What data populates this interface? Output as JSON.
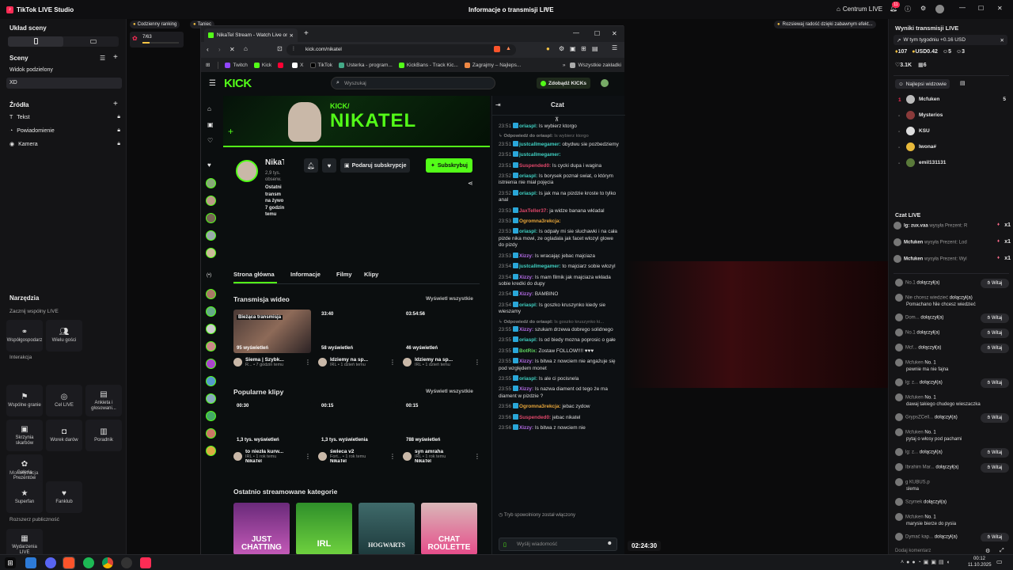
{
  "titlebar": {
    "app": "TikTok LIVE Studio",
    "center": "Informacje o transmisji LIVE",
    "centrum": "Centrum LIVE",
    "notif_count": "11"
  },
  "left": {
    "scene_layout": "Układ sceny",
    "scenes_title": "Sceny",
    "scenes": [
      "Widok podzielony",
      "XD"
    ],
    "sources_title": "Źródła",
    "sources": [
      "Tekst",
      "Powiadomienie",
      "Kamera"
    ],
    "tools_title": "Narzędzia",
    "collab_title": "Zacznij wspólny LIVE",
    "collab": [
      "Współgospodarz",
      "Wielu gości"
    ],
    "interaction_title": "Interakcja",
    "interaction": [
      "Wspólne granie",
      "Cel LIVE",
      "Ankieta i głosowani...",
      "Skrzynia skarbów",
      "Worek darów",
      "Poradnik",
      "Galeria Prezentów"
    ],
    "monet_title": "Monetyzacja",
    "monet": [
      "Superfan",
      "Fanklub"
    ],
    "ext_title": "Rozszerz publiczność",
    "ext": [
      "Wydarzenia LIVE"
    ]
  },
  "floating": {
    "daily": "Codzienny ranking",
    "daily_sub": "7/63",
    "taniec": "Taniec",
    "banner": "Rozsiewaj radość dzięki zabawnym efekt..."
  },
  "browser": {
    "tab_title": "NikaTel Stream - Watch Live on K",
    "url": "kick.com/nikatel",
    "bookmarks": [
      "Twitch",
      "Kick",
      "",
      "X",
      "TikTok",
      "Usterka - program...",
      "KickBans - Track Kic...",
      "Zagrajmy – Najleps..."
    ],
    "all_bookmarks": "Wszystkie zakładki"
  },
  "kick": {
    "logo": "KICK",
    "search_placeholder": "Wyszukaj",
    "get_kicks": "Zdobądź KICKs",
    "banner_top": "KICK/",
    "banner_name": "NIKATEL",
    "channel_name": "NikaTel",
    "followers": "2,9 tys. obserw.",
    "last_stream": "Ostatni transm na żywo 7 godzin temu",
    "gift_sub": "Podaruj subskrypcje",
    "subscribe": "Subskrybuj",
    "tabs": [
      "Strona główna",
      "Informacje",
      "Filmy",
      "Klipy"
    ],
    "videos_title": "Transmisja wideo",
    "see_all": "Wyświetl wszystkie",
    "videos": [
      {
        "dur": "Bieżąca transmisja",
        "views": "95 wyświetleń",
        "title": "Siema | Szybk...",
        "sub": "R... • 7 godzin temu"
      },
      {
        "dur": "33:40",
        "views": "58 wyświetleń",
        "title": "Idziemy na sp...",
        "sub": "IRL • 1 dzień temu"
      },
      {
        "dur": "03:54:56",
        "views": "46 wyświetleń",
        "title": "Idziemy na sp...",
        "sub": "IRL • 1 dzień temu"
      }
    ],
    "clips_title": "Popularne klipy",
    "clips": [
      {
        "dur": "00:30",
        "views": "1,3 tys. wyświetleń",
        "title": "to niezła kurw...",
        "sub": "IRL • 1 rok temu",
        "author": "NikaTel"
      },
      {
        "dur": "00:15",
        "views": "1,3 tys. wyświetlenia",
        "title": "świeca v2",
        "sub": "Fort... • 1 rok temu",
        "author": "NikaTel"
      },
      {
        "dur": "00:15",
        "views": "788 wyświetleń",
        "title": "syn amraha",
        "sub": "IRL • 1 rok temu",
        "author": "NikaTel"
      }
    ],
    "cats_title": "Ostatnio streamowane kategorie",
    "cats": [
      "JUST CHATTING",
      "IRL",
      "HOGWARTS",
      "CHAT ROULETTE"
    ],
    "chat_title": "Czat",
    "chat": [
      {
        "t": "23:51",
        "u": "oriaspl:",
        "c": "#3fd0c2",
        "m": "Is wybierz ktorgo"
      },
      {
        "t": "",
        "u": "Odpowiedź do oriaspl:",
        "c": "#888",
        "m": "Is wybierz ktorgo"
      },
      {
        "t": "23:51",
        "u": "justcallmegamer:",
        "c": "#3fd0c2",
        "m": "obydwu sie pozbedziemy"
      },
      {
        "t": "23:51",
        "u": "justcallmegamer:",
        "c": "#3fd0c2",
        "m": ""
      },
      {
        "t": "23:51",
        "u": "Suspended0:",
        "c": "#e0476a",
        "m": "Is cycki dupa i wagina"
      },
      {
        "t": "23:52",
        "u": "oriaspl:",
        "c": "#3fd0c2",
        "m": "Is borysek poznał swiat, o którym istnienia nie miał pojęcia"
      },
      {
        "t": "23:52",
        "u": "oriaspl:",
        "c": "#3fd0c2",
        "m": "Is jak ma na pizdzie kroste to tylko anal"
      },
      {
        "t": "23:53",
        "u": "JaxTeller37:",
        "c": "#e0476a",
        "m": "ja widze banana wkladal"
      },
      {
        "t": "23:53",
        "u": "Ogromna3rekcja:",
        "c": "#e7a53a",
        "m": ""
      },
      {
        "t": "23:53",
        "u": "oriaspl:",
        "c": "#3fd0c2",
        "m": "Is odpały mi sie sluchawki i na cała pizde nika mowi, ze ogladala jak facet wlozyl glowe do pizdy"
      },
      {
        "t": "23:53",
        "u": "Xizzy:",
        "c": "#b46be6",
        "m": "Is wracając jebac majciaza"
      },
      {
        "t": "23:54",
        "u": "justcallmegamer:",
        "c": "#3fd0c2",
        "m": "to majciarz sobie wlozyl"
      },
      {
        "t": "23:54",
        "u": "Xizzy:",
        "c": "#b46be6",
        "m": "Is mam filmik jak majciaza wkłada sobie kredki do dupy"
      },
      {
        "t": "23:54",
        "u": "Xizzy:",
        "c": "#b46be6",
        "m": "BAMBINO"
      },
      {
        "t": "23:54",
        "u": "oriaspl:",
        "c": "#3fd0c2",
        "m": "Is goszko kruszynko kiedy sie wieszamy"
      },
      {
        "t": "",
        "u": "Odpowiedź do oriaspl:",
        "c": "#888",
        "m": "Is goszko kruszynko ki..."
      },
      {
        "t": "23:55",
        "u": "Xizzy:",
        "c": "#b46be6",
        "m": "szukam drzewa dobrego solidnego"
      },
      {
        "t": "23:55",
        "u": "oriaspl:",
        "c": "#3fd0c2",
        "m": "Is od biedy mozna poprosic o gałe"
      },
      {
        "t": "23:55",
        "u": "BotRix:",
        "c": "#5fd35f",
        "m": "Zostaw FOLLOW!!!! ♥♥♥"
      },
      {
        "t": "23:55",
        "u": "Xizzy:",
        "c": "#b46be6",
        "m": "Is bitwa z nowciem nie angażuje się pod względem monet"
      },
      {
        "t": "23:55",
        "u": "oriaspl:",
        "c": "#3fd0c2",
        "m": "Is ale ci pocisnela"
      },
      {
        "t": "23:55",
        "u": "Xizzy:",
        "c": "#b46be6",
        "m": "Is nazwa diament od tego że ma diament w pizdzie ?"
      },
      {
        "t": "23:56",
        "u": "Ogromna3rekcja:",
        "c": "#e7a53a",
        "m": "jebac zydow"
      },
      {
        "t": "23:56",
        "u": "Suspended0:",
        "c": "#e0476a",
        "m": "jebac nikatel"
      },
      {
        "t": "23:56",
        "u": "Xizzy:",
        "c": "#b46be6",
        "m": "Is bitwa z nowciem nie"
      }
    ],
    "slow_mode": "Tryb spowolniony został włączony",
    "send_placeholder": "Wyślij wiadomość"
  },
  "timer": "02:24:30",
  "right": {
    "title": "Wyniki transmisji LIVE",
    "week": "W tym tygodniu +0.16 USD",
    "stats": [
      "107",
      "USD0.42",
      "5",
      "3",
      "3.1K",
      "6"
    ],
    "best": "Najlepsi widzowie",
    "viewers": [
      {
        "r": "1",
        "n": "Mcfuken",
        "v": "5"
      },
      {
        "r": "-",
        "n": "Mysterios",
        "v": ""
      },
      {
        "r": "-",
        "n": "KSU",
        "v": ""
      },
      {
        "r": "-",
        "n": "Iwona#",
        "v": ""
      },
      {
        "r": "-",
        "n": "emil131131",
        "v": ""
      }
    ],
    "live_chat": "Czat LIVE",
    "gifts": [
      {
        "n": "lg: zux.vaa",
        "m": "wysyła Prezent: R",
        "x": "x1"
      },
      {
        "n": "Mcfuken",
        "m": "wysyła Prezent: Lod",
        "x": "x1"
      },
      {
        "n": "Mcfuken",
        "m": "wysyła Prezent: Wyl",
        "x": "x1"
      }
    ],
    "events": [
      {
        "n": "No.1",
        "m": "dołączył(a)",
        "w": true
      },
      {
        "n": "Nie chcesz wiedzieć",
        "m": "dołączył(a)",
        "w": false,
        "sub": "Pomachano Nie chcesz wiedzieć"
      },
      {
        "n": "Dom...",
        "m": "dołączył(a)",
        "w": true
      },
      {
        "n": "No.1",
        "m": "dołączył(a)",
        "w": true
      },
      {
        "n": "Mcf...",
        "m": "dołączył(a)",
        "w": true
      },
      {
        "n": "Mcfuken",
        "m": "No. 1",
        "w": false,
        "sub": "pewnie ma nie fajna"
      },
      {
        "n": "lg: z...",
        "m": "dołączył(a)",
        "w": true
      },
      {
        "n": "Mcfuken",
        "m": "No. 1",
        "w": false,
        "sub": "dawaj takiego chudego wieszaczka"
      },
      {
        "n": "GrypsZCell...",
        "m": "dołączył(a)",
        "w": true
      },
      {
        "n": "Mcfuken",
        "m": "No. 1",
        "w": false,
        "sub": "pytaj o włosy pod pachami"
      },
      {
        "n": "lg: z...",
        "m": "dołączył(a)",
        "w": true
      },
      {
        "n": "Ibrahim Mar...",
        "m": "dołączył(a)",
        "w": true
      },
      {
        "n": "g KUBUS.p",
        "m": "",
        "w": false,
        "sub": "slema"
      },
      {
        "n": "Szymek",
        "m": "dołączył(a)",
        "w": false
      },
      {
        "n": "Mcfuken",
        "m": "No. 1",
        "w": false,
        "sub": "marysie bierze do pysia"
      },
      {
        "n": "Dymać kap...",
        "m": "dołączył(a)",
        "w": true
      }
    ],
    "witaj": "Witaj",
    "comment": "Dodaj komentarz"
  },
  "taskbar": {
    "time": "00:12",
    "date": "11.10.2025"
  }
}
